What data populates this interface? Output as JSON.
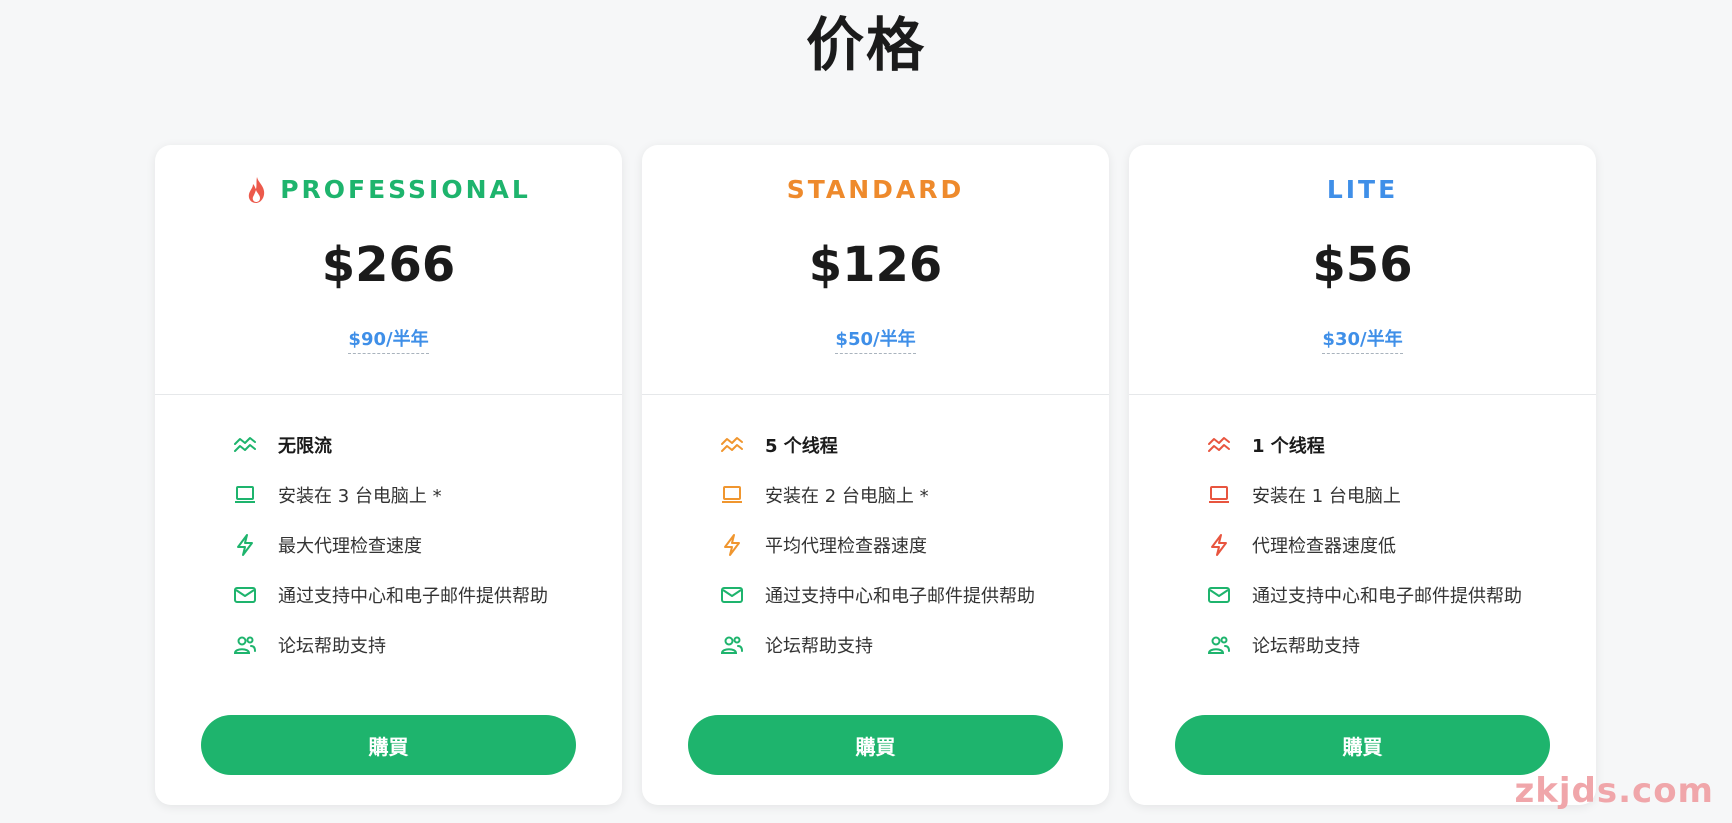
{
  "page": {
    "title": "价格"
  },
  "plans": [
    {
      "name": "PROFESSIONAL",
      "name_color": "#1eb46d",
      "badge_icon": "flame-icon",
      "price": "$266",
      "half_year": "$90/半年",
      "icon_accent": "#1eb46d",
      "features": [
        {
          "icon": "trend-icon",
          "text": "无限流",
          "bold": true
        },
        {
          "icon": "laptop-icon",
          "text": "安装在 3 台电脑上 *"
        },
        {
          "icon": "bolt-icon",
          "text": "最大代理检查速度"
        },
        {
          "icon": "mail-icon",
          "text": "通过支持中心和电子邮件提供帮助"
        },
        {
          "icon": "users-icon",
          "text": "论坛帮助支持"
        }
      ],
      "button_label": "購買"
    },
    {
      "name": "STANDARD",
      "name_color": "#ee8a2c",
      "price": "$126",
      "half_year": "$50/半年",
      "icon_accent": "#f0962f",
      "features": [
        {
          "icon": "trend-icon",
          "text": "5 个线程",
          "bold": true
        },
        {
          "icon": "laptop-icon",
          "text": "安装在 2 台电脑上 *"
        },
        {
          "icon": "bolt-icon",
          "text": "平均代理检查器速度"
        },
        {
          "icon": "mail-icon",
          "text": "通过支持中心和电子邮件提供帮助"
        },
        {
          "icon": "users-icon",
          "text": "论坛帮助支持"
        }
      ],
      "button_label": "購買"
    },
    {
      "name": "LITE",
      "name_color": "#3f8fe8",
      "price": "$56",
      "half_year": "$30/半年",
      "icon_accent": "#e8553f",
      "features": [
        {
          "icon": "trend-icon",
          "text": "1 个线程",
          "bold": true
        },
        {
          "icon": "laptop-icon",
          "text": "安装在 1 台电脑上"
        },
        {
          "icon": "bolt-icon",
          "text": "代理检查器速度低"
        },
        {
          "icon": "mail-icon",
          "text": "通过支持中心和电子邮件提供帮助"
        },
        {
          "icon": "users-icon",
          "text": "论坛帮助支持"
        }
      ],
      "button_label": "購買"
    }
  ],
  "colors": {
    "button": "#1eb46d",
    "mail_users_icon": "#1eb46d",
    "link": "#3f8fe8"
  },
  "watermark": "zkjds.com"
}
